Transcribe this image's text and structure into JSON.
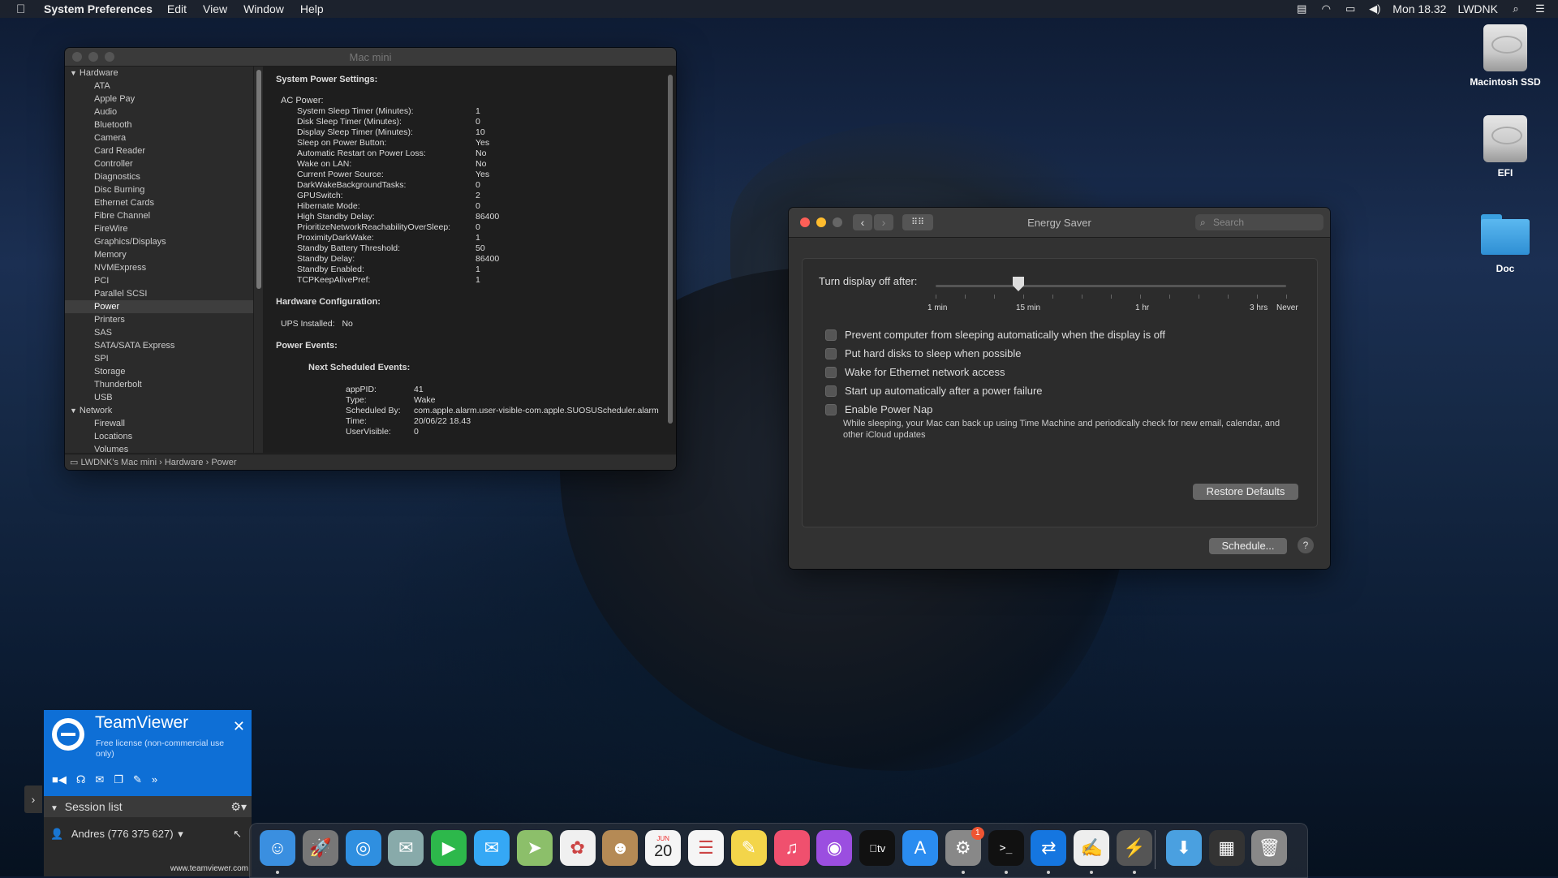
{
  "menubar": {
    "app_name": "System Preferences",
    "items": [
      "Edit",
      "View",
      "Window",
      "Help"
    ],
    "clock": "Mon 18.32",
    "user": "LWDNK"
  },
  "sysinfo": {
    "title": "Mac mini",
    "sidebar": [
      {
        "type": "header",
        "label": "Hardware"
      },
      {
        "type": "item",
        "label": "ATA"
      },
      {
        "type": "item",
        "label": "Apple Pay"
      },
      {
        "type": "item",
        "label": "Audio"
      },
      {
        "type": "item",
        "label": "Bluetooth"
      },
      {
        "type": "item",
        "label": "Camera"
      },
      {
        "type": "item",
        "label": "Card Reader"
      },
      {
        "type": "item",
        "label": "Controller"
      },
      {
        "type": "item",
        "label": "Diagnostics"
      },
      {
        "type": "item",
        "label": "Disc Burning"
      },
      {
        "type": "item",
        "label": "Ethernet Cards"
      },
      {
        "type": "item",
        "label": "Fibre Channel"
      },
      {
        "type": "item",
        "label": "FireWire"
      },
      {
        "type": "item",
        "label": "Graphics/Displays"
      },
      {
        "type": "item",
        "label": "Memory"
      },
      {
        "type": "item",
        "label": "NVMExpress"
      },
      {
        "type": "item",
        "label": "PCI"
      },
      {
        "type": "item",
        "label": "Parallel SCSI"
      },
      {
        "type": "item",
        "label": "Power",
        "selected": true
      },
      {
        "type": "item",
        "label": "Printers"
      },
      {
        "type": "item",
        "label": "SAS"
      },
      {
        "type": "item",
        "label": "SATA/SATA Express"
      },
      {
        "type": "item",
        "label": "SPI"
      },
      {
        "type": "item",
        "label": "Storage"
      },
      {
        "type": "item",
        "label": "Thunderbolt"
      },
      {
        "type": "item",
        "label": "USB"
      },
      {
        "type": "header",
        "label": "Network"
      },
      {
        "type": "item",
        "label": "Firewall"
      },
      {
        "type": "item",
        "label": "Locations"
      },
      {
        "type": "item",
        "label": "Volumes"
      }
    ],
    "heading_power_settings": "System Power Settings:",
    "heading_ac_power": "AC Power:",
    "ac_power": [
      {
        "k": "System Sleep Timer (Minutes):",
        "v": "1"
      },
      {
        "k": "Disk Sleep Timer (Minutes):",
        "v": "0"
      },
      {
        "k": "Display Sleep Timer (Minutes):",
        "v": "10"
      },
      {
        "k": "Sleep on Power Button:",
        "v": "Yes"
      },
      {
        "k": "Automatic Restart on Power Loss:",
        "v": "No"
      },
      {
        "k": "Wake on LAN:",
        "v": "No"
      },
      {
        "k": "Current Power Source:",
        "v": "Yes"
      },
      {
        "k": "DarkWakeBackgroundTasks:",
        "v": "0"
      },
      {
        "k": "GPUSwitch:",
        "v": "2"
      },
      {
        "k": "Hibernate Mode:",
        "v": "0"
      },
      {
        "k": "High Standby Delay:",
        "v": "86400"
      },
      {
        "k": "PrioritizeNetworkReachabilityOverSleep:",
        "v": "0"
      },
      {
        "k": "ProximityDarkWake:",
        "v": "1"
      },
      {
        "k": "Standby Battery Threshold:",
        "v": "50"
      },
      {
        "k": "Standby Delay:",
        "v": "86400"
      },
      {
        "k": "Standby Enabled:",
        "v": "1"
      },
      {
        "k": "TCPKeepAlivePref:",
        "v": "1"
      }
    ],
    "heading_hw_config": "Hardware Configuration:",
    "ups_label": "UPS Installed:",
    "ups_value": "No",
    "heading_power_events": "Power Events:",
    "heading_next_events": "Next Scheduled Events:",
    "events": [
      {
        "k": "appPID:",
        "v": "41"
      },
      {
        "k": "Type:",
        "v": "Wake"
      },
      {
        "k": "Scheduled By:",
        "v": "com.apple.alarm.user-visible-com.apple.SUOSUScheduler.alarm"
      },
      {
        "k": "Time:",
        "v": "20/06/22 18.43"
      },
      {
        "k": "UserVisible:",
        "v": "0"
      }
    ],
    "breadcrumb": [
      "LWDNK's Mac mini",
      "Hardware",
      "Power"
    ]
  },
  "energy": {
    "title": "Energy Saver",
    "search_placeholder": "Search",
    "slider_label": "Turn display off after:",
    "slider_value_minutes": 10,
    "tick_labels": [
      "1 min",
      "15 min",
      "1 hr",
      "3 hrs",
      "Never"
    ],
    "checkboxes": [
      {
        "label": "Prevent computer from sleeping automatically when the display is off",
        "checked": false
      },
      {
        "label": "Put hard disks to sleep when possible",
        "checked": false
      },
      {
        "label": "Wake for Ethernet network access",
        "checked": false
      },
      {
        "label": "Start up automatically after a power failure",
        "checked": false
      },
      {
        "label": "Enable Power Nap",
        "checked": false
      }
    ],
    "power_nap_desc": "While sleeping, your Mac can back up using Time Machine and periodically check for new email, calendar, and other iCloud updates",
    "restore_defaults": "Restore Defaults",
    "schedule": "Schedule...",
    "help": "?"
  },
  "desktop": {
    "icons": [
      {
        "label": "Macintosh SSD",
        "kind": "drive"
      },
      {
        "label": "EFI",
        "kind": "drive"
      },
      {
        "label": "Doc",
        "kind": "folder"
      }
    ]
  },
  "teamviewer": {
    "title": "TeamViewer",
    "subtitle": "Free license (non-commercial use only)",
    "session_list": "Session list",
    "user": "Andres (776 375 627)",
    "url": "www.teamviewer.com"
  },
  "dock": {
    "calendar_month": "JUN",
    "calendar_day": "20",
    "tv_label": "tv",
    "sysprefs_badge": "1",
    "apps": [
      {
        "name": "finder-icon",
        "color": "#3a8fe0",
        "glyph": "☺",
        "running": true
      },
      {
        "name": "launchpad-icon",
        "color": "#777",
        "glyph": "🚀",
        "running": false
      },
      {
        "name": "safari-icon",
        "color": "#2f8fe0",
        "glyph": "◎",
        "running": false
      },
      {
        "name": "preview-icon",
        "color": "#8aa",
        "glyph": "✉",
        "running": false
      },
      {
        "name": "facetime-icon",
        "color": "#2db84b",
        "glyph": "▶",
        "running": false
      },
      {
        "name": "messages-icon",
        "color": "#35a8f5",
        "glyph": "✉",
        "running": false
      },
      {
        "name": "maps-icon",
        "color": "#8cbf6a",
        "glyph": "➤",
        "running": false
      },
      {
        "name": "photos-icon",
        "color": "#f0f0f0",
        "glyph": "✿",
        "running": false
      },
      {
        "name": "contacts-icon",
        "color": "#b58a55",
        "glyph": "☻",
        "running": false
      },
      {
        "name": "calendar-icon",
        "color": "#f5f5f5",
        "glyph": "",
        "running": false
      },
      {
        "name": "reminders-icon",
        "color": "#f5f5f5",
        "glyph": "☰",
        "running": false
      },
      {
        "name": "notes-icon",
        "color": "#f3d54a",
        "glyph": "✎",
        "running": false
      },
      {
        "name": "music-icon",
        "color": "#f0506e",
        "glyph": "♫",
        "running": false
      },
      {
        "name": "podcasts-icon",
        "color": "#9b4ee0",
        "glyph": "◉",
        "running": false
      },
      {
        "name": "apple-tv-icon",
        "color": "#111",
        "glyph": "",
        "running": false
      },
      {
        "name": "app-store-icon",
        "color": "#2a8cf0",
        "glyph": "A",
        "running": false
      },
      {
        "name": "system-preferences-icon",
        "color": "#888",
        "glyph": "⚙",
        "running": true
      },
      {
        "name": "terminal-icon",
        "color": "#111",
        "glyph": ">_",
        "running": true
      },
      {
        "name": "teamviewer-icon",
        "color": "#1576e0",
        "glyph": "⇄",
        "running": true
      },
      {
        "name": "textedit-icon",
        "color": "#eee",
        "glyph": "✍",
        "running": true
      },
      {
        "name": "system-information-icon",
        "color": "#555",
        "glyph": "⚡",
        "running": true
      },
      {
        "name": "downloads-folder-icon",
        "color": "#4aa0e0",
        "glyph": "⬇",
        "running": false
      },
      {
        "name": "screenshot-stack-icon",
        "color": "#333",
        "glyph": "▦",
        "running": false
      },
      {
        "name": "trash-icon",
        "color": "#888",
        "glyph": "🗑",
        "running": false
      }
    ]
  }
}
